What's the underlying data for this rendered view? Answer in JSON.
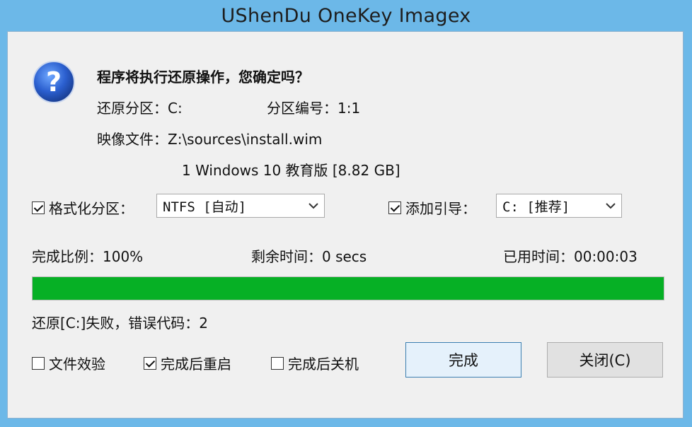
{
  "window": {
    "title": "UShenDu OneKey Imagex"
  },
  "confirm": {
    "question": "程序将执行还原操作，您确定吗？",
    "partition_label": "还原分区：C:",
    "partition_number": "分区编号：1:1",
    "image_file": "映像文件：Z:\\sources\\install.wim",
    "image_entry": "1 Windows 10 教育版 [8.82 GB]"
  },
  "options": {
    "format": {
      "label": "格式化分区：",
      "checked": true,
      "value": "NTFS [自动]"
    },
    "boot": {
      "label": "添加引导：",
      "checked": true,
      "value": "C: [推荐]"
    }
  },
  "progress": {
    "ratio_text": "完成比例：100%",
    "remaining_text": "剩余时间：0 secs",
    "elapsed_text": "已用时间：00:00:03",
    "percent": 100,
    "color": "#06b025"
  },
  "status": {
    "message": "还原[C:]失败，错误代码：2"
  },
  "bottom": {
    "verify": {
      "label": "文件效验",
      "checked": false
    },
    "reboot": {
      "label": "完成后重启",
      "checked": true
    },
    "shutdown": {
      "label": "完成后关机",
      "checked": false
    },
    "finish_label": "完成",
    "close_label": "关闭(C)"
  },
  "icons": {
    "question": "question-icon",
    "dropdown": "chevron-down-icon"
  }
}
